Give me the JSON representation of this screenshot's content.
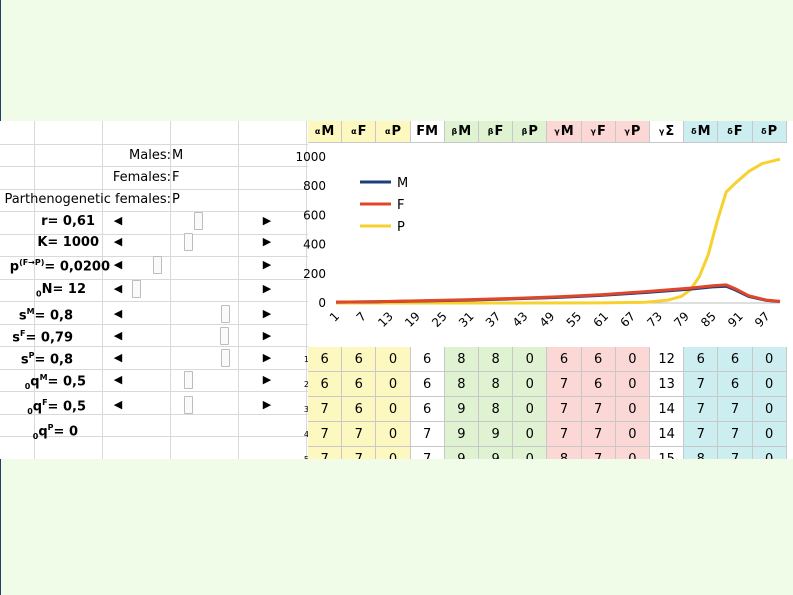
{
  "labels": [
    {
      "name": "Males:",
      "value": "M"
    },
    {
      "name": "Females:",
      "value": "F"
    },
    {
      "name": "Parthenogenetic females:",
      "value": "P"
    }
  ],
  "params": [
    {
      "label": "r= 0,61",
      "thumb": 0.55
    },
    {
      "label": "K= 1000",
      "thumb": 0.47
    },
    {
      "label": "p",
      "sup": "(F→P)",
      "rest": "= 0,0200",
      "thumb": 0.22
    },
    {
      "label": "N= 12",
      "pre": "0",
      "thumb": 0.05
    },
    {
      "label": "s",
      "sup": "M",
      "rest": "= 0,8",
      "thumb": 0.77
    },
    {
      "label": "s",
      "sup": "F",
      "rest": "= 0,79",
      "thumb": 0.76
    },
    {
      "label": "s",
      "sup": "P",
      "rest": "= 0,8",
      "thumb": 0.77
    },
    {
      "label": "q",
      "pre": "0",
      "sup": "M",
      "rest": "= 0,5",
      "thumb": 0.47
    },
    {
      "label": "q",
      "pre": "0",
      "sup": "F",
      "rest": "= 0,5",
      "thumb": 0.47
    },
    {
      "label": "q",
      "pre": "0",
      "sup": "P",
      "rest": "= 0",
      "thumb": null
    }
  ],
  "columns": [
    {
      "sup": "α",
      "main": "M",
      "bg": "#fdf7c0"
    },
    {
      "sup": "α",
      "main": "F",
      "bg": "#fdf7c0"
    },
    {
      "sup": "α",
      "main": "P",
      "bg": "#fdf7c0"
    },
    {
      "sup": "",
      "main": "FM",
      "bg": "#ffffff"
    },
    {
      "sup": "β",
      "main": "M",
      "bg": "#dff2d2"
    },
    {
      "sup": "β",
      "main": "F",
      "bg": "#dff2d2"
    },
    {
      "sup": "β",
      "main": "P",
      "bg": "#dff2d2"
    },
    {
      "sup": "γ",
      "main": "M",
      "bg": "#fbd8d6"
    },
    {
      "sup": "γ",
      "main": "F",
      "bg": "#fbd8d6"
    },
    {
      "sup": "γ",
      "main": "P",
      "bg": "#fbd8d6"
    },
    {
      "sup": "γ",
      "main": "Σ",
      "bg": "#ffffff"
    },
    {
      "sup": "δ",
      "main": "M",
      "bg": "#cdeef0"
    },
    {
      "sup": "δ",
      "main": "F",
      "bg": "#cdeef0"
    },
    {
      "sup": "δ",
      "main": "P",
      "bg": "#cdeef0"
    }
  ],
  "rows": [
    {
      "n": "1",
      "v": [
        "6",
        "6",
        "0",
        "6",
        "8",
        "8",
        "0",
        "6",
        "6",
        "0",
        "12",
        "6",
        "6",
        "0"
      ]
    },
    {
      "n": "2",
      "v": [
        "6",
        "6",
        "0",
        "6",
        "8",
        "8",
        "0",
        "7",
        "6",
        "0",
        "13",
        "7",
        "6",
        "0"
      ]
    },
    {
      "n": "3",
      "v": [
        "7",
        "6",
        "0",
        "6",
        "9",
        "8",
        "0",
        "7",
        "7",
        "0",
        "14",
        "7",
        "7",
        "0"
      ]
    },
    {
      "n": "4",
      "v": [
        "7",
        "7",
        "0",
        "7",
        "9",
        "9",
        "0",
        "7",
        "7",
        "0",
        "14",
        "7",
        "7",
        "0"
      ]
    },
    {
      "n": "5",
      "v": [
        "7",
        "7",
        "0",
        "7",
        "9",
        "9",
        "0",
        "8",
        "7",
        "0",
        "15",
        "8",
        "7",
        "0"
      ]
    }
  ],
  "chart_data": {
    "type": "line",
    "ylim": [
      0,
      1000
    ],
    "yticks": [
      "0",
      "200",
      "400",
      "600",
      "800",
      "1000"
    ],
    "xticks": [
      "1",
      "7",
      "13",
      "19",
      "25",
      "31",
      "37",
      "43",
      "49",
      "55",
      "61",
      "67",
      "73",
      "79",
      "85",
      "91",
      "97"
    ],
    "legend_position": "top-left",
    "series": [
      {
        "name": "M",
        "color": "#1f3d7a",
        "x": [
          1,
          10,
          20,
          30,
          40,
          50,
          60,
          70,
          80,
          85,
          88,
          90,
          93,
          97,
          100
        ],
        "values": [
          6,
          9,
          14,
          20,
          28,
          38,
          52,
          72,
          95,
          110,
          115,
          90,
          45,
          18,
          10
        ]
      },
      {
        "name": "F",
        "color": "#e0462a",
        "x": [
          1,
          10,
          20,
          30,
          40,
          50,
          60,
          70,
          80,
          85,
          88,
          90,
          93,
          97,
          100
        ],
        "values": [
          6,
          9,
          15,
          22,
          31,
          42,
          57,
          78,
          102,
          118,
          124,
          98,
          50,
          20,
          11
        ]
      },
      {
        "name": "P",
        "color": "#f7d22e",
        "x": [
          1,
          40,
          60,
          70,
          75,
          78,
          80,
          82,
          84,
          86,
          88,
          90,
          93,
          96,
          100
        ],
        "values": [
          0,
          0,
          1,
          5,
          20,
          45,
          90,
          180,
          330,
          560,
          760,
          820,
          900,
          955,
          985
        ]
      }
    ]
  }
}
